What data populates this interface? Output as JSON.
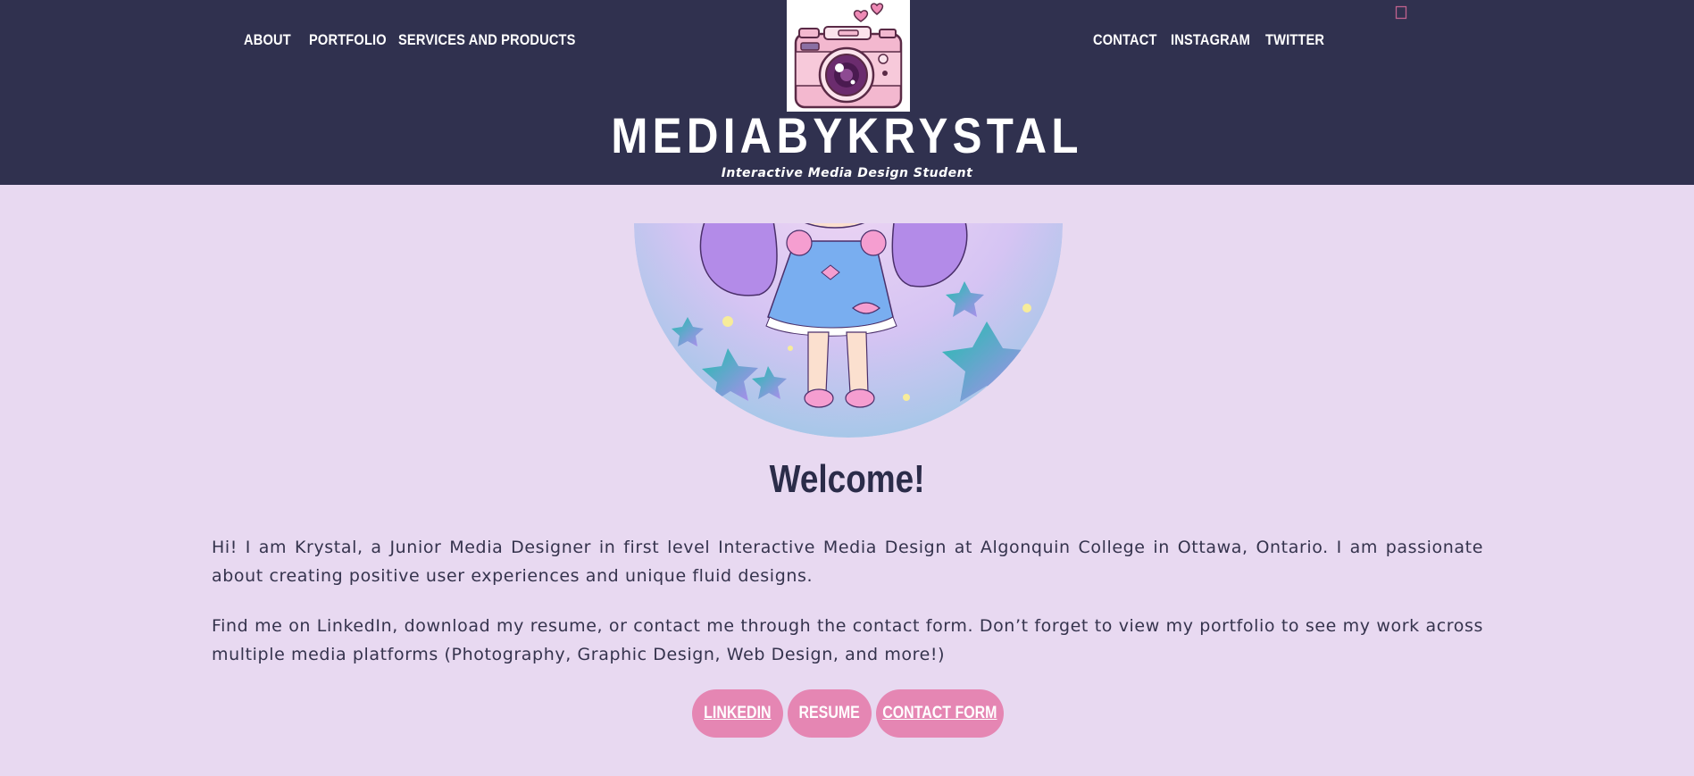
{
  "nav": {
    "left": [
      "ABOUT",
      "PORTFOLIO",
      "SERVICES AND PRODUCTS"
    ],
    "right": [
      "CONTACT",
      "INSTAGRAM",
      "TWITTER"
    ]
  },
  "site": {
    "title": "MEDIABYKRYSTAL",
    "tagline": "Interactive Media Design Student",
    "logo_icon": "camera-with-hearts-icon",
    "cart_icon": "cart-icon"
  },
  "main": {
    "heading": "Welcome!",
    "paragraphs": [
      "Hi! I am Krystal, a Junior Media Designer in first level Interactive Media Design at Algonquin College in Ottawa, Ontario. I am passionate about creating positive user experiences and unique fluid designs.",
      "Find me on LinkedIn, download my resume, or contact me through the contact form. Don’t forget to view my portfolio to see my work across multiple media platforms (Photography, Graphic Design, Web Design, and more!)"
    ],
    "buttons": [
      "LINKEDIN",
      "RESUME",
      "CONTACT FORM"
    ]
  },
  "colors": {
    "header_bg": "#30314f",
    "page_bg": "#e8d9f1",
    "button_bg": "#e586b3",
    "heading": "#2b2c49",
    "accent_pink": "#e586b3"
  }
}
